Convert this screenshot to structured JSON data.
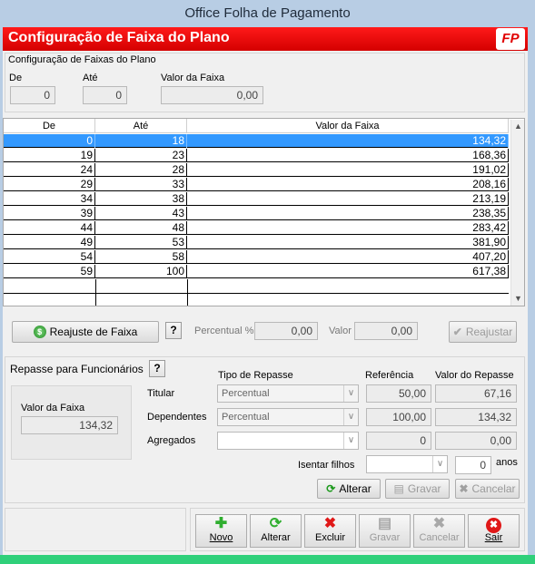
{
  "window": {
    "title": "Office Folha de Pagamento"
  },
  "header": {
    "title": "Configuração de Faixa do Plano",
    "logo": "FP",
    "color": "#e00000"
  },
  "filter": {
    "group_title": "Configuração de Faixas do Plano",
    "de_label": "De",
    "de_value": "0",
    "ate_label": "Até",
    "ate_value": "0",
    "valor_label": "Valor da Faixa",
    "valor_value": "0,00"
  },
  "grid": {
    "columns": [
      "De",
      "Até",
      "Valor da Faixa"
    ],
    "rows": [
      [
        "0",
        "18",
        "134,32"
      ],
      [
        "19",
        "23",
        "168,36"
      ],
      [
        "24",
        "28",
        "191,02"
      ],
      [
        "29",
        "33",
        "208,16"
      ],
      [
        "34",
        "38",
        "213,19"
      ],
      [
        "39",
        "43",
        "238,35"
      ],
      [
        "44",
        "48",
        "283,42"
      ],
      [
        "49",
        "53",
        "381,90"
      ],
      [
        "54",
        "58",
        "407,20"
      ],
      [
        "59",
        "100",
        "617,38"
      ]
    ],
    "selected_row": 0
  },
  "reajuste": {
    "button_label": "Reajuste de Faixa",
    "help": "?",
    "percentual_label": "Percentual %",
    "percentual_value": "0,00",
    "valor_label": "Valor",
    "valor_value": "0,00",
    "reajustar_label": "Reajustar"
  },
  "repasse": {
    "title": "Repasse para Funcionários",
    "help": "?",
    "valor_faixa_label": "Valor da Faixa",
    "valor_faixa_value": "134,32",
    "col_tipo": "Tipo de Repasse",
    "col_referencia": "Referência",
    "col_valor": "Valor do Repasse",
    "titular_label": "Titular",
    "titular_tipo": "Percentual",
    "titular_ref": "50,00",
    "titular_valor": "67,16",
    "dependentes_label": "Dependentes",
    "dependentes_tipo": "Percentual",
    "dependentes_ref": "100,00",
    "dependentes_valor": "134,32",
    "agregados_label": "Agregados",
    "agregados_tipo": "",
    "agregados_ref": "0",
    "agregados_valor": "0,00",
    "isentar_label": "Isentar filhos",
    "isentar_value": "",
    "anos_value": "0",
    "anos_label": "anos",
    "alterar": "Alterar",
    "gravar": "Gravar",
    "cancelar": "Cancelar"
  },
  "toolbar": {
    "novo": "Novo",
    "alterar": "Alterar",
    "excluir": "Excluir",
    "gravar": "Gravar",
    "cancelar": "Cancelar",
    "sair": "Sair"
  }
}
